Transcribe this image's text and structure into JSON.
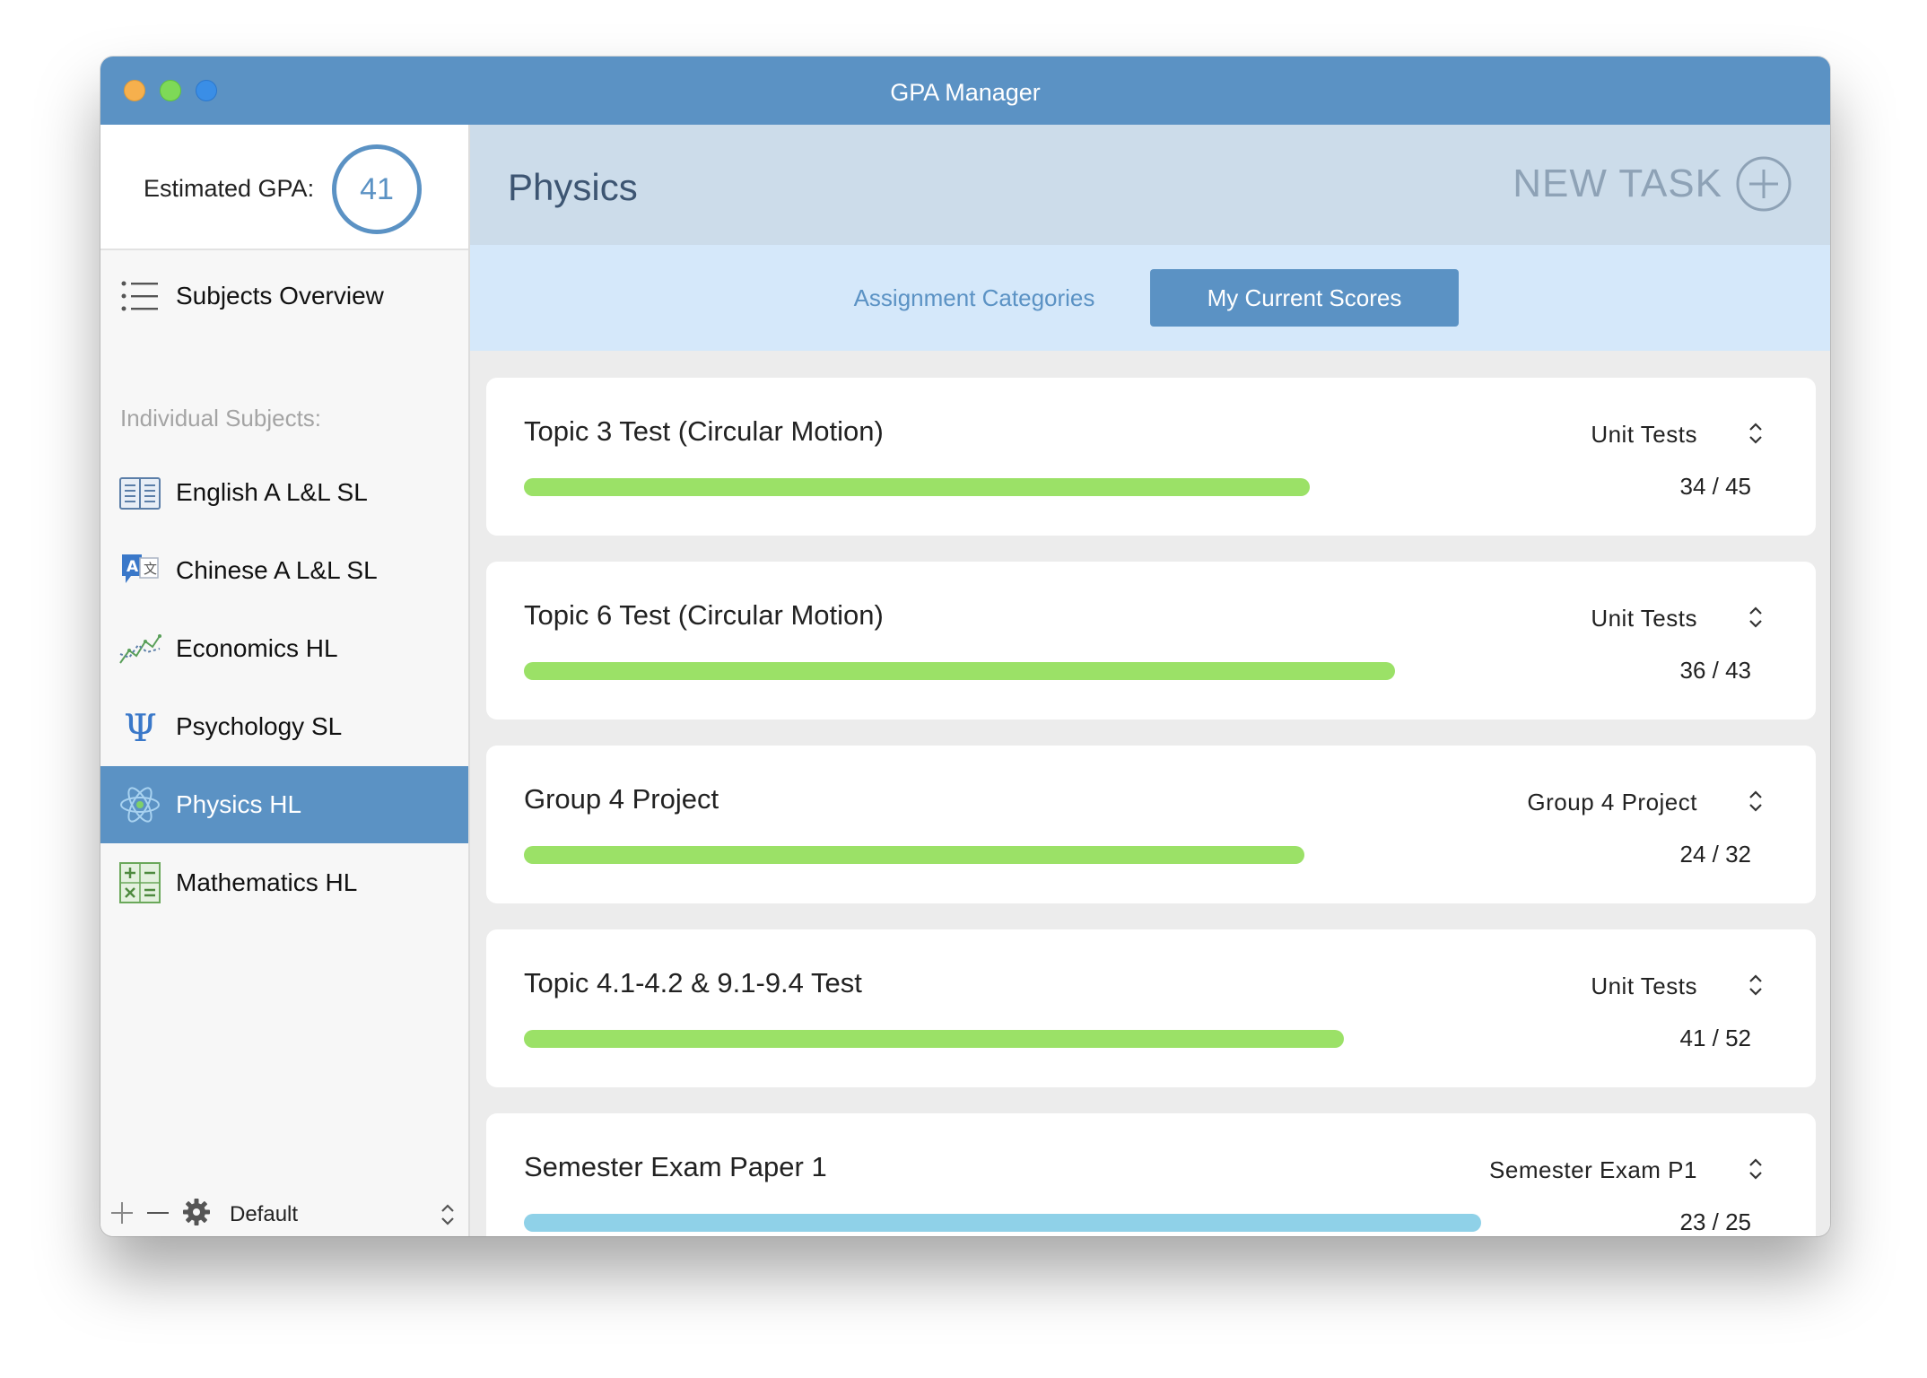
{
  "window": {
    "title": "GPA Manager"
  },
  "sidebar": {
    "gpa_label": "Estimated GPA:",
    "gpa_value": "41",
    "overview_label": "Subjects Overview",
    "section_heading": "Individual Subjects:",
    "items": [
      {
        "label": "English A L&L SL",
        "icon": "book-icon",
        "active": false
      },
      {
        "label": "Chinese A L&L SL",
        "icon": "translate-icon",
        "active": false
      },
      {
        "label": "Economics HL",
        "icon": "chart-line-icon",
        "active": false
      },
      {
        "label": "Psychology SL",
        "icon": "psi-icon",
        "active": false
      },
      {
        "label": "Physics HL",
        "icon": "atom-icon",
        "active": true
      },
      {
        "label": "Mathematics HL",
        "icon": "math-operators-icon",
        "active": false
      }
    ],
    "footer": {
      "profile": "Default"
    }
  },
  "main": {
    "subject_title": "Physics",
    "new_task_label": "NEW TASK",
    "tabs": [
      {
        "label": "Assignment Categories",
        "active": false
      },
      {
        "label": "My Current Scores",
        "active": true
      }
    ],
    "tasks": [
      {
        "title": "Topic 3 Test (Circular Motion)",
        "category": "Unit Tests",
        "score": 34,
        "max": 45,
        "score_text": "34 / 45",
        "progress": 0.755,
        "bar_color": "#9be167"
      },
      {
        "title": "Topic 6 Test (Circular Motion)",
        "category": "Unit Tests",
        "score": 36,
        "max": 43,
        "score_text": "36 / 43",
        "progress": 0.837,
        "bar_color": "#9be167"
      },
      {
        "title": "Group 4 Project",
        "category": "Group 4 Project",
        "score": 24,
        "max": 32,
        "score_text": "24 / 32",
        "progress": 0.75,
        "bar_color": "#9be167"
      },
      {
        "title": "Topic 4.1-4.2 & 9.1-9.4 Test",
        "category": "Unit Tests",
        "score": 41,
        "max": 52,
        "score_text": "41 / 52",
        "progress": 0.788,
        "bar_color": "#9be167"
      },
      {
        "title": "Semester Exam Paper 1",
        "category": "Semester Exam P1",
        "score": 23,
        "max": 25,
        "score_text": "23 / 25",
        "progress": 0.92,
        "bar_color": "#8fd1e8"
      }
    ]
  },
  "colors": {
    "accent": "#5b92c4",
    "header_bg": "#ccdcea",
    "tabbar_bg": "#d5e8fa",
    "progress_green": "#9be167",
    "progress_blue": "#8fd1e8"
  }
}
